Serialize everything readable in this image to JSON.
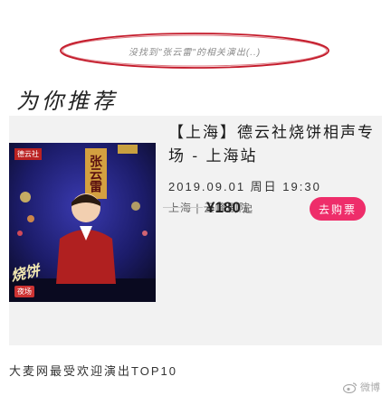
{
  "search": {
    "text": "没找到\"张云雷\"的相关演出(..)"
  },
  "section": {
    "title": "为你推荐"
  },
  "event": {
    "poster": {
      "tag": "德云社",
      "name_tile": "张云雷",
      "title": "烧饼",
      "badge": "夜场"
    },
    "title": "【上海】德云社烧饼相声专场 - 上海站",
    "date": "2019.09.01 周日 19:30",
    "venue": "上海 | 云峰剧院",
    "price": "¥180",
    "price_suffix": "起",
    "buy_label": "去购票"
  },
  "footer": {
    "text": "大麦网最受欢迎演出TOP10"
  },
  "watermark": {
    "text": "微博"
  },
  "colors": {
    "buy_button": "#ee2d6a",
    "card_bg": "#f2f2f2",
    "search_outline": "#c41a2a"
  }
}
